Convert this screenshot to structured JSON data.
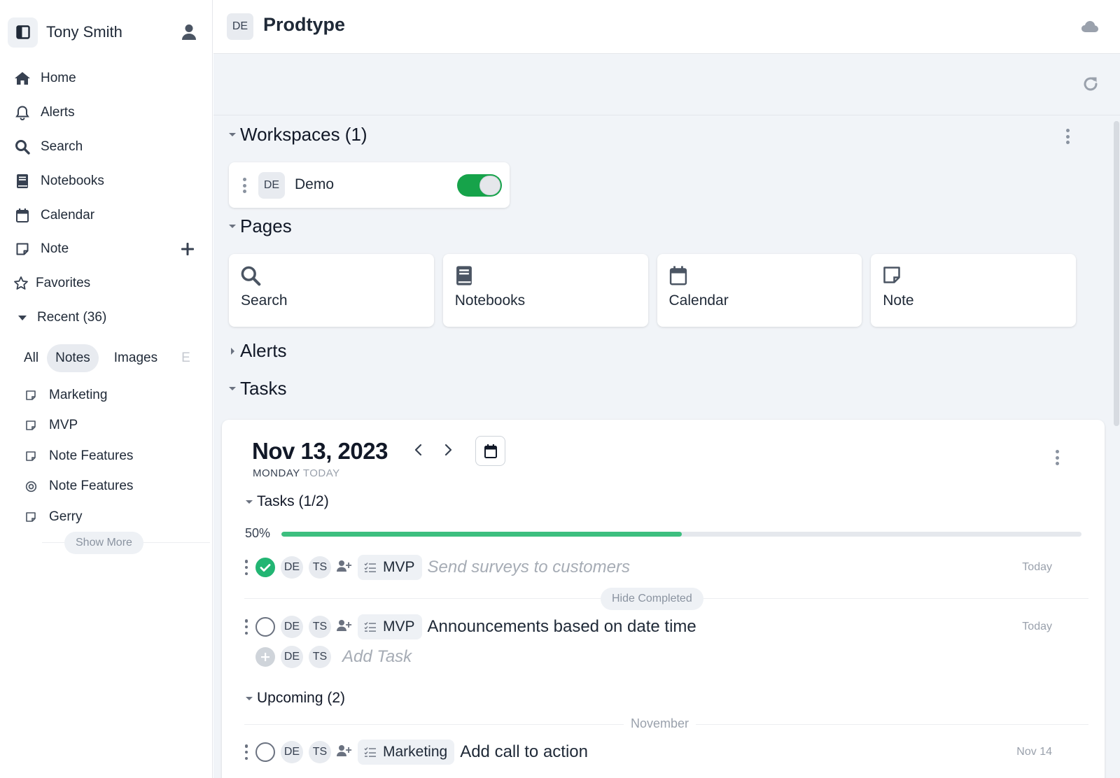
{
  "sidebar": {
    "user_name": "Tony Smith",
    "nav": [
      {
        "label": "Home",
        "icon": "home-icon"
      },
      {
        "label": "Alerts",
        "icon": "bell-icon"
      },
      {
        "label": "Search",
        "icon": "search-icon"
      },
      {
        "label": "Notebooks",
        "icon": "notebook-icon"
      },
      {
        "label": "Calendar",
        "icon": "calendar-icon"
      },
      {
        "label": "Note",
        "icon": "note-icon"
      },
      {
        "label": "Favorites",
        "icon": "star-icon"
      },
      {
        "label": "Recent (36)",
        "icon": "caret-down-icon"
      }
    ],
    "filters": [
      "All",
      "Notes",
      "Images",
      "E"
    ],
    "active_filter": "Notes",
    "recent": [
      {
        "label": "Marketing",
        "icon": "note-icon"
      },
      {
        "label": "MVP",
        "icon": "note-icon"
      },
      {
        "label": "Note Features",
        "icon": "note-icon"
      },
      {
        "label": "Note Features",
        "icon": "target-icon"
      },
      {
        "label": "Gerry",
        "icon": "note-icon"
      }
    ],
    "show_more": "Show More"
  },
  "header": {
    "badge": "DE",
    "title": "Prodtype"
  },
  "sections": {
    "workspaces": "Workspaces (1)",
    "pages": "Pages",
    "alerts": "Alerts",
    "tasks": "Tasks"
  },
  "workspace": {
    "badge": "DE",
    "name": "Demo",
    "enabled": true
  },
  "pages": [
    {
      "label": "Search",
      "icon": "search-icon"
    },
    {
      "label": "Notebooks",
      "icon": "notebook-icon"
    },
    {
      "label": "Calendar",
      "icon": "calendar-icon"
    },
    {
      "label": "Note",
      "icon": "note-icon"
    }
  ],
  "tasks_panel": {
    "date": "Nov 13, 2023",
    "weekday": "MONDAY",
    "today_label": "TODAY",
    "tasks_header": "Tasks (1/2)",
    "progress_label": "50%",
    "progress": 0.5,
    "hide_completed": "Hide Completed",
    "tasks": [
      {
        "workspace": "DE",
        "user": "TS",
        "project": "MVP",
        "text": "Send surveys to customers",
        "due": "Today",
        "done": true
      },
      {
        "workspace": "DE",
        "user": "TS",
        "project": "MVP",
        "text": "Announcements based on date time",
        "due": "Today",
        "done": false
      }
    ],
    "add_task": {
      "workspace": "DE",
      "user": "TS",
      "placeholder": "Add Task"
    },
    "upcoming_header": "Upcoming (2)",
    "month": "November",
    "upcoming": [
      {
        "workspace": "DE",
        "user": "TS",
        "project": "Marketing",
        "text": "Add call to action",
        "due": "Nov 14",
        "done": false
      }
    ]
  },
  "colors": {
    "accent_green": "#22b573",
    "toggle_on": "#16a34a",
    "background": "#f1f4f8"
  }
}
